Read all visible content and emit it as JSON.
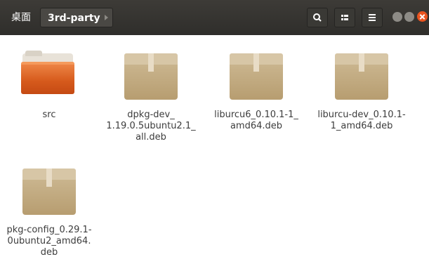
{
  "breadcrumb": {
    "home_label": "桌面",
    "current_label": "3rd-party"
  },
  "toolbar": {
    "search_icon": "search-icon",
    "view_icon": "list-view-icon",
    "menu_icon": "hamburger-menu-icon"
  },
  "window_controls": [
    "minimize",
    "maximize",
    "close"
  ],
  "colors": {
    "headerbar": "#2f2e2b",
    "close_button": "#e95420",
    "folder": "#e0661e",
    "package": "#c4ac82"
  },
  "files": [
    {
      "type": "folder",
      "icon": "folder-icon",
      "label_lines": [
        "src"
      ]
    },
    {
      "type": "deb",
      "icon": "package-icon",
      "label_lines": [
        "dpkg-dev_",
        "1.19.0.5ubuntu2.1_",
        "all.deb"
      ]
    },
    {
      "type": "deb",
      "icon": "package-icon",
      "label_lines": [
        "liburcu6_0.10.1-1_",
        "amd64.deb"
      ]
    },
    {
      "type": "deb",
      "icon": "package-icon",
      "label_lines": [
        "liburcu-dev_0.10.1-",
        "1_amd64.deb"
      ]
    },
    {
      "type": "deb",
      "icon": "package-icon",
      "label_lines": [
        "pkg-config_0.29.1-",
        "0ubuntu2_amd64.",
        "deb"
      ]
    }
  ]
}
